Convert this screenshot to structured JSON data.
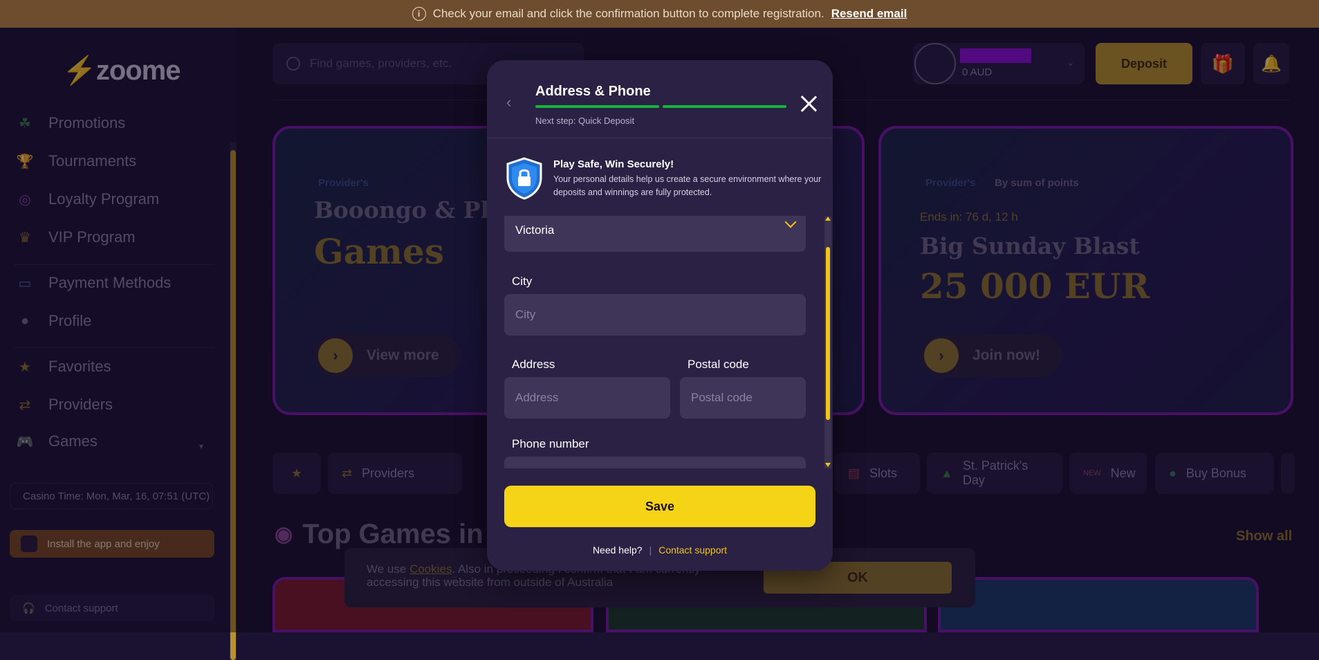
{
  "banner": {
    "text": "Check your email and click the confirmation button to complete registration.",
    "link": "Resend email"
  },
  "logo": {
    "text": "zoome"
  },
  "sidebar": {
    "items": [
      {
        "label": "Promotions",
        "icon": "clover-icon"
      },
      {
        "label": "Tournaments",
        "icon": "trophy-icon"
      },
      {
        "label": "Loyalty Program",
        "icon": "target-icon"
      },
      {
        "label": "VIP Program",
        "icon": "crown-icon"
      },
      {
        "label": "Payment Methods",
        "icon": "card-icon"
      },
      {
        "label": "Profile",
        "icon": "user-icon"
      },
      {
        "label": "Favorites",
        "icon": "star-icon"
      },
      {
        "label": "Providers",
        "icon": "providers-icon"
      },
      {
        "label": "Games",
        "icon": "gamepad-icon"
      }
    ],
    "casino_time": "Casino Time: Mon, Mar, 16, 07:51 (UTC)",
    "install": "Install the app and enjoy",
    "contact": "Contact support"
  },
  "header": {
    "search_placeholder": "Find games, providers, etc.",
    "balance": "0 AUD",
    "deposit": "Deposit"
  },
  "promos": [
    {
      "tag": "Provider's",
      "title": "Booongo & Plays",
      "subtitle": "Games",
      "button": "View more"
    },
    {
      "tag": "Provider's",
      "tag2": "By sum of points",
      "ends": "Ends in: 76 d, 12 h",
      "title": "Big Sunday Blast",
      "subtitle": "25 000 EUR",
      "button": "Join now!"
    }
  ],
  "categories": [
    {
      "label": "",
      "icon": "star-icon"
    },
    {
      "label": "Providers",
      "icon": "providers-icon"
    },
    {
      "label": "Slots",
      "icon": "slots-icon"
    },
    {
      "label": "St. Patrick's Day",
      "icon": "hat-icon"
    },
    {
      "label": "New",
      "icon": "new-badge-icon"
    },
    {
      "label": "Buy Bonus",
      "icon": "bag-icon"
    }
  ],
  "section": {
    "title": "Top Games in A",
    "show_all": "Show all"
  },
  "cookies": {
    "text_pre": "We use ",
    "link": "Cookies",
    "text_post": ". Also in proceeding I confirm that I am currently accessing this website from outside of Australia",
    "ok": "OK"
  },
  "modal": {
    "title": "Address & Phone",
    "next_step": "Next step: Quick Deposit",
    "secure_title": "Play Safe, Win Securely!",
    "secure_desc": "Your personal details help us create a secure environment where your deposits and winnings are fully protected.",
    "state_value": "Victoria",
    "city_label": "City",
    "city_placeholder": "City",
    "address_label": "Address",
    "address_placeholder": "Address",
    "postal_label": "Postal code",
    "postal_placeholder": "Postal code",
    "phone_label": "Phone number",
    "save": "Save",
    "help": "Need help?",
    "contact": "Contact support"
  }
}
